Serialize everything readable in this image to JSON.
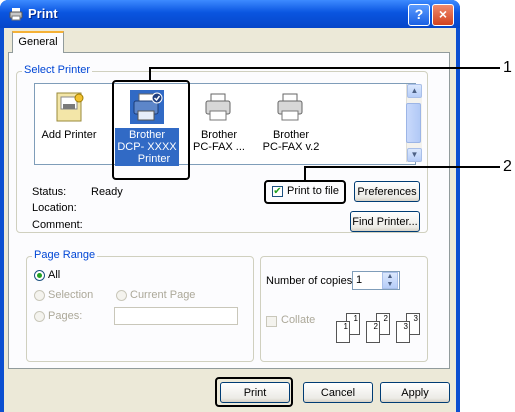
{
  "window": {
    "title": "Print",
    "help_glyph": "?",
    "close_glyph": "×"
  },
  "tabs": [
    {
      "label": "General"
    }
  ],
  "select_printer": {
    "label": "Select Printer",
    "printers": [
      {
        "name": "Add Printer",
        "icon": "add-printer-icon"
      },
      {
        "name_lines": [
          "Brother",
          "DCP- XXXX",
          "Printer"
        ],
        "icon": "printer-default-icon",
        "selected": true
      },
      {
        "name_lines": [
          "Brother",
          "PC-FAX ..."
        ],
        "icon": "fax-printer-icon"
      },
      {
        "name_lines": [
          "Brother",
          "PC-FAX v.2"
        ],
        "icon": "fax-printer-icon"
      }
    ],
    "status_label": "Status:",
    "status_value": "Ready",
    "location_label": "Location:",
    "comment_label": "Comment:",
    "print_to_file_label": "Print to file",
    "print_to_file_checked": true,
    "preferences_label": "Preferences",
    "find_printer_label": "Find Printer..."
  },
  "page_range": {
    "label": "Page Range",
    "all_label": "All",
    "selection_label": "Selection",
    "current_page_label": "Current Page",
    "pages_label": "Pages:",
    "pages_value": ""
  },
  "copies": {
    "label": "Number of copies:",
    "value": "1",
    "collate_label": "Collate",
    "collate_checked": false,
    "collate_pages": [
      "1",
      "1",
      "2",
      "2",
      "3",
      "3"
    ]
  },
  "buttons": {
    "print": "Print",
    "cancel": "Cancel",
    "apply": "Apply"
  },
  "callouts": [
    "1",
    "2"
  ],
  "colors": {
    "title_bar": "#0a55e0",
    "selection": "#316ac5",
    "group_label": "#0046d5",
    "face": "#ece9d8"
  }
}
